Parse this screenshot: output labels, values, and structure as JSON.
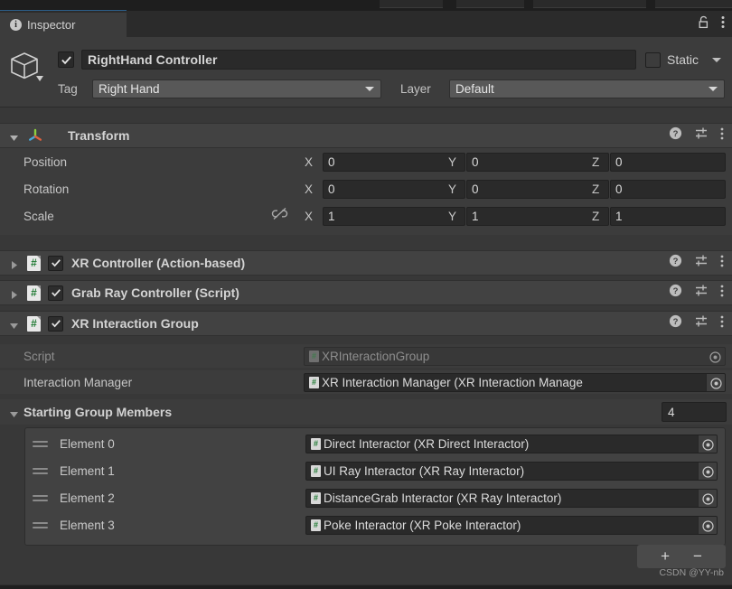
{
  "window": {
    "tab_label": "Inspector",
    "tab_icon": "info-icon",
    "lock_icon": "unlocked-padlock-icon",
    "menu_icon": "kebab-menu-icon",
    "accent_color": "#2c5d87"
  },
  "object_header": {
    "enabled_checkbox": true,
    "name": "RightHand Controller",
    "gameobject_icon": "cube-icon",
    "static_label": "Static",
    "static_checked": false,
    "tag_label": "Tag",
    "tag_value": "Right Hand",
    "layer_label": "Layer",
    "layer_value": "Default"
  },
  "transform": {
    "title": "Transform",
    "icon": "transform-axis-icon",
    "expanded": true,
    "help_icon": "help-circle-icon",
    "preset_icon": "preset-slider-icon",
    "menu_icon": "kebab-menu-icon",
    "rows": [
      {
        "label": "Position",
        "x": "0",
        "y": "0",
        "z": "0",
        "lock": false
      },
      {
        "label": "Rotation",
        "x": "0",
        "y": "0",
        "z": "0",
        "lock": false
      },
      {
        "label": "Scale",
        "x": "1",
        "y": "1",
        "z": "1",
        "lock": true
      }
    ],
    "axis_x": "X",
    "axis_y": "Y",
    "axis_z": "Z",
    "scale_lock_icon": "linked-scale-off-icon"
  },
  "components": [
    {
      "title": "XR Controller (Action-based)",
      "expanded": false,
      "enabled": true,
      "icon": "script-icon"
    },
    {
      "title": "Grab Ray Controller (Script)",
      "expanded": false,
      "enabled": true,
      "icon": "script-icon"
    },
    {
      "title": "XR Interaction Group",
      "expanded": true,
      "enabled": true,
      "icon": "script-icon"
    }
  ],
  "interaction_group": {
    "script_label": "Script",
    "script_value": "XRInteractionGroup",
    "script_disabled": true,
    "manager_label": "Interaction Manager",
    "manager_value": "XR Interaction Manager (XR Interaction Manage",
    "members_label": "Starting Group Members",
    "members_count": "4",
    "members_expanded": true,
    "elements": [
      {
        "label": "Element 0",
        "value": "Direct Interactor (XR Direct Interactor)"
      },
      {
        "label": "Element 1",
        "value": "UI Ray Interactor (XR Ray Interactor)"
      },
      {
        "label": "Element 2",
        "value": "DistanceGrab Interactor (XR Ray Interactor)"
      },
      {
        "label": "Element 3",
        "value": "Poke Interactor (XR Poke Interactor)"
      }
    ],
    "add_label": "+",
    "remove_label": "−"
  },
  "watermark": "CSDN @YY-nb"
}
